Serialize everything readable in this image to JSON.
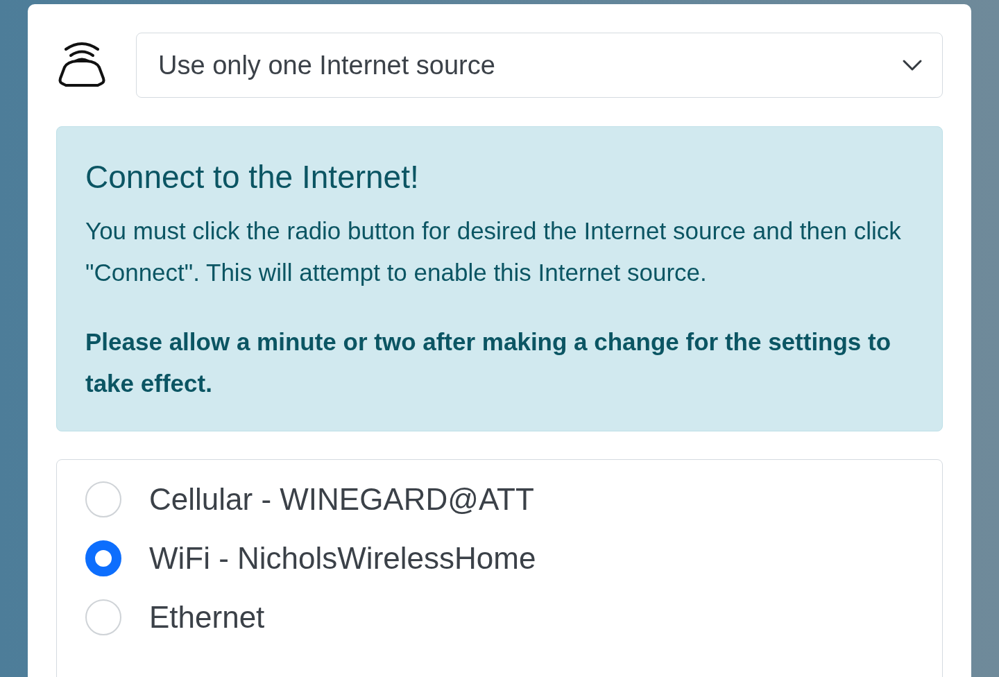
{
  "source_select": {
    "value": "Use only one Internet source"
  },
  "alert": {
    "title": "Connect to the Internet!",
    "body": "You must click the radio button for desired the Internet source and then click \"Connect\". This will attempt to enable this Internet source.",
    "note": "Please allow a minute or two after making a change for the settings to take effect."
  },
  "sources": [
    {
      "label": "Cellular - WINEGARD@ATT",
      "selected": false
    },
    {
      "label": "WiFi - NicholsWirelessHome",
      "selected": true
    },
    {
      "label": "Ethernet",
      "selected": false
    }
  ]
}
